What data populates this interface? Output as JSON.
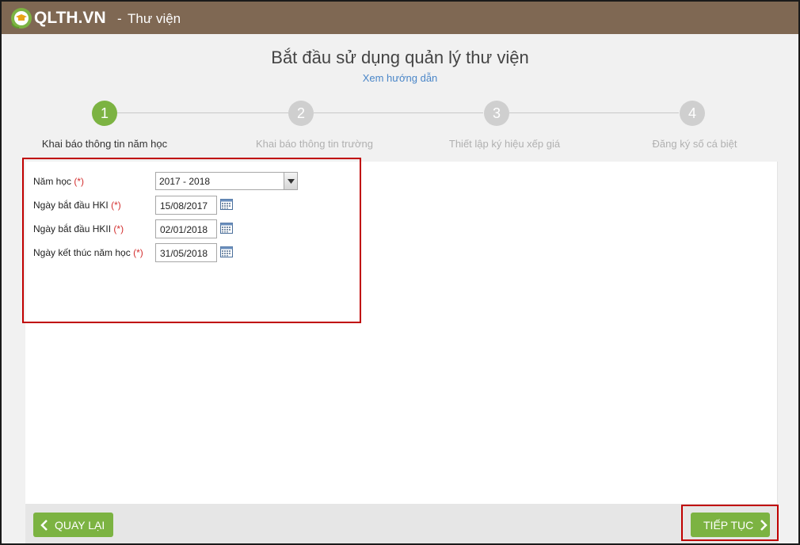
{
  "header": {
    "logo_text": "QLTH.VN",
    "separator": "-",
    "app_name": "Thư viện",
    "brand_color": "#7f6853"
  },
  "page": {
    "title": "Bắt đầu sử dụng quản lý thư viện",
    "guide_link": "Xem hướng dẫn"
  },
  "steps": [
    {
      "number": "1",
      "label": "Khai báo thông tin năm học",
      "active": true
    },
    {
      "number": "2",
      "label": "Khai báo thông tin trường",
      "active": false
    },
    {
      "number": "3",
      "label": "Thiết lập ký hiệu xếp giá",
      "active": false
    },
    {
      "number": "4",
      "label": "Đăng ký số cá biệt",
      "active": false
    }
  ],
  "form": {
    "required_mark": "(*)",
    "school_year": {
      "label": "Năm học",
      "value": "2017 - 2018"
    },
    "hk1_start": {
      "label": "Ngày bắt đầu HKI",
      "value": "15/08/2017"
    },
    "hk2_start": {
      "label": "Ngày bắt đầu HKII",
      "value": "02/01/2018"
    },
    "year_end": {
      "label": "Ngày kết thúc năm học",
      "value": "31/05/2018"
    }
  },
  "footer": {
    "back_label": "QUAY LẠI",
    "next_label": "TIẾP TỤC"
  },
  "colors": {
    "accent_green": "#7cb342",
    "highlight_red": "#c00000",
    "link_blue": "#4a86c8"
  },
  "icons": {
    "logo": "graduation-cap-leaf-icon",
    "select_arrow": "chevron-down-icon",
    "calendar": "calendar-icon",
    "back": "chevron-left-icon",
    "next": "chevron-right-icon"
  }
}
